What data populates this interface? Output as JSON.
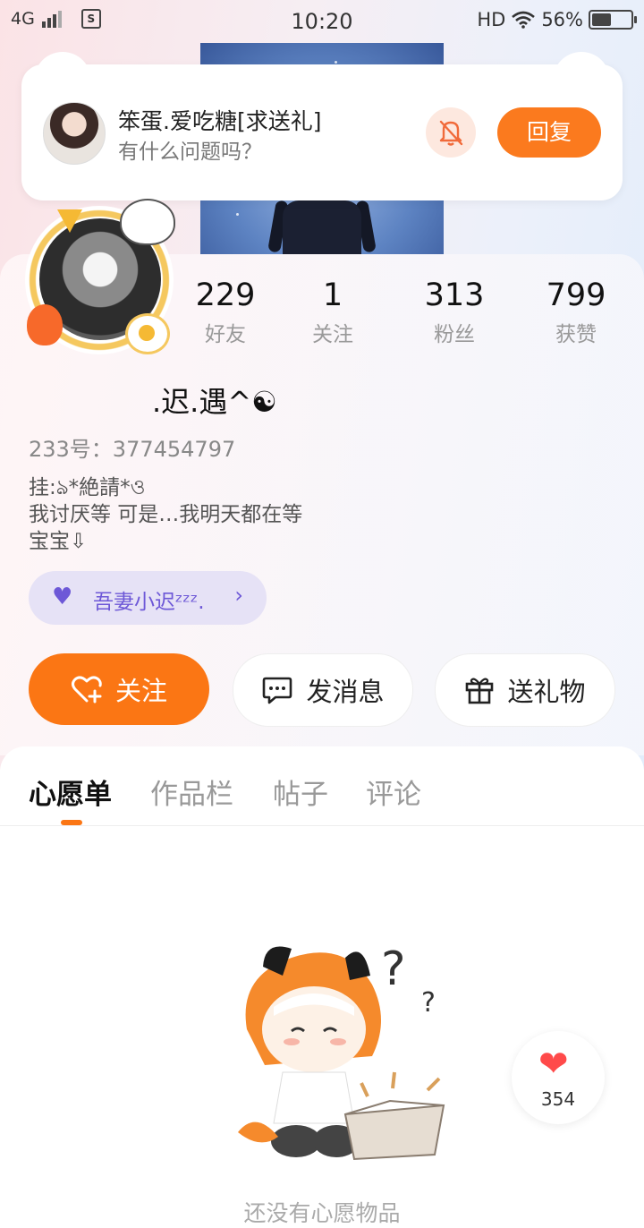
{
  "status_bar": {
    "network": "4G",
    "sim_label": "S",
    "time": "10:20",
    "hd": "HD",
    "battery": "56%",
    "battery_level": 0.56
  },
  "notification": {
    "name": "笨蛋.爱吃糖[求送礼]",
    "message": "有什么问题吗？",
    "reply_label": "回复",
    "mute_icon": "bell-off-icon"
  },
  "profile": {
    "stats": [
      {
        "value": "229",
        "label": "好友"
      },
      {
        "value": "1",
        "label": "关注"
      },
      {
        "value": "313",
        "label": "粉丝"
      },
      {
        "value": "799",
        "label": "获赞"
      }
    ],
    "nickname": ".迟.遇^☯",
    "uid": "233号：377454797",
    "bio": "挂:ঌ*絶請*ও\n我讨厌等 可是…我明天都在等\n宝宝⇩",
    "badge": {
      "icon": "purple-heart-icon",
      "text": "吾妻小迟ᶻᶻᶻ.",
      "chevron": "›"
    }
  },
  "actions": {
    "follow": "关注",
    "message": "发消息",
    "gift": "送礼物"
  },
  "tabs": [
    "心愿单",
    "作品栏",
    "帖子",
    "评论"
  ],
  "active_tab": "心愿单",
  "empty_state": "还没有心愿物品",
  "like_count": "354",
  "colors": {
    "accent": "#fb7614",
    "badge_purple": "#6d58d7"
  }
}
